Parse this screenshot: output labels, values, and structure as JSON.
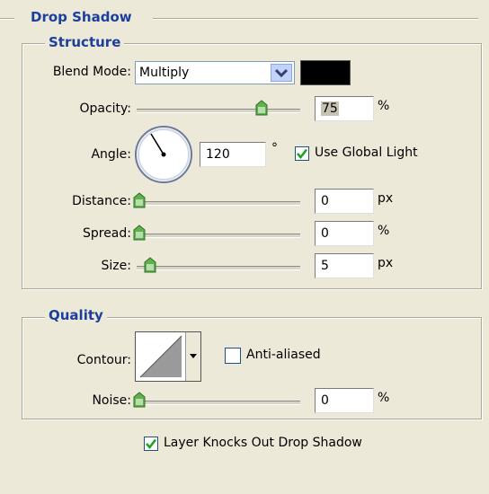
{
  "drop_shadow": {
    "title": "Drop Shadow",
    "structure": {
      "title": "Structure",
      "blend_mode_label": "Blend Mode:",
      "blend_mode_value": "Multiply",
      "shadow_color": "#000000",
      "opacity_label": "Opacity:",
      "opacity_value": "75",
      "opacity_unit": "%",
      "opacity_fraction": 0.75,
      "angle_label": "Angle:",
      "angle_value": "120",
      "angle_unit": "°",
      "use_global_light_label": "Use Global Light",
      "use_global_light_checked": true,
      "distance_label": "Distance:",
      "distance_value": "0",
      "distance_unit": "px",
      "distance_fraction": 0.0,
      "spread_label": "Spread:",
      "spread_value": "0",
      "spread_unit": "%",
      "spread_fraction": 0.0,
      "size_label": "Size:",
      "size_value": "5",
      "size_unit": "px",
      "size_fraction": 0.03
    },
    "quality": {
      "title": "Quality",
      "contour_label": "Contour:",
      "anti_aliased_label": "Anti-aliased",
      "anti_aliased_checked": false,
      "noise_label": "Noise:",
      "noise_value": "0",
      "noise_unit": "%",
      "noise_fraction": 0.0
    },
    "layer_knocks_out_label": "Layer Knocks Out Drop Shadow",
    "layer_knocks_out_checked": true
  },
  "colors": {
    "panel_bg": "#ece9d8",
    "header_blue": "#1c3f9c",
    "check_green": "#21a121",
    "slider_thumb": "#5fb24b"
  }
}
